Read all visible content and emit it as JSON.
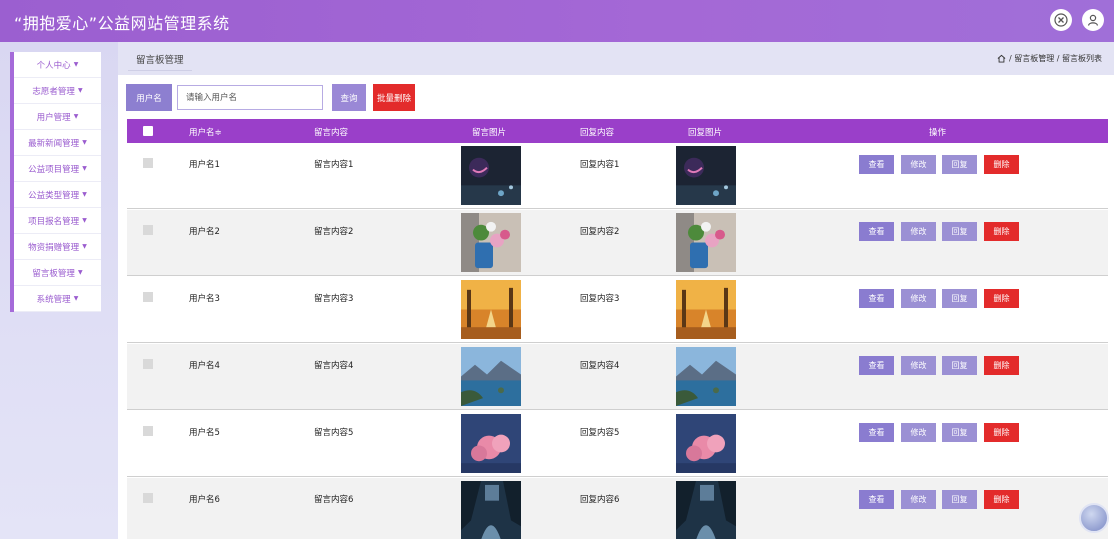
{
  "header": {
    "title": "“拥抱爱心”公益网站管理系统"
  },
  "sidebar": {
    "items": [
      {
        "label": "个人中心"
      },
      {
        "label": "志愿者管理"
      },
      {
        "label": "用户管理"
      },
      {
        "label": "最新新闻管理"
      },
      {
        "label": "公益项目管理"
      },
      {
        "label": "公益类型管理"
      },
      {
        "label": "项目报名管理"
      },
      {
        "label": "物资捐赠管理"
      },
      {
        "label": "留言板管理"
      },
      {
        "label": "系统管理"
      }
    ],
    "caret": "▼"
  },
  "breadcrumb": {
    "tab": "留言板管理",
    "path": "/ 留言板管理 / 留言板列表"
  },
  "search": {
    "label": "用户名",
    "placeholder": "请输入用户名",
    "query_button": "查询",
    "bulk_delete_button": "批量删除"
  },
  "table": {
    "columns": [
      "用户名≑",
      "留言内容",
      "留言图片",
      "回复内容",
      "回复图片",
      "操作"
    ],
    "actions": {
      "view": "查看",
      "edit": "修改",
      "reply": "回复",
      "delete": "删除"
    },
    "rows": [
      {
        "username": "用户名1",
        "content": "留言内容1",
        "reply": "回复内容1",
        "image": "night-scene"
      },
      {
        "username": "用户名2",
        "content": "留言内容2",
        "reply": "回复内容2",
        "image": "flower-vase"
      },
      {
        "username": "用户名3",
        "content": "留言内容3",
        "reply": "回复内容3",
        "image": "autumn-forest"
      },
      {
        "username": "用户名4",
        "content": "留言内容4",
        "reply": "回复内容4",
        "image": "lake-mountains"
      },
      {
        "username": "用户名5",
        "content": "留言内容5",
        "reply": "回复内容5",
        "image": "pink-clouds"
      },
      {
        "username": "用户名6",
        "content": "留言内容6",
        "reply": "回复内容6",
        "image": "river-valley"
      }
    ]
  },
  "colors": {
    "header": "#a468d6",
    "table_header": "#9a3fc9",
    "button": "#8a7cd0",
    "danger": "#e32b2b"
  }
}
